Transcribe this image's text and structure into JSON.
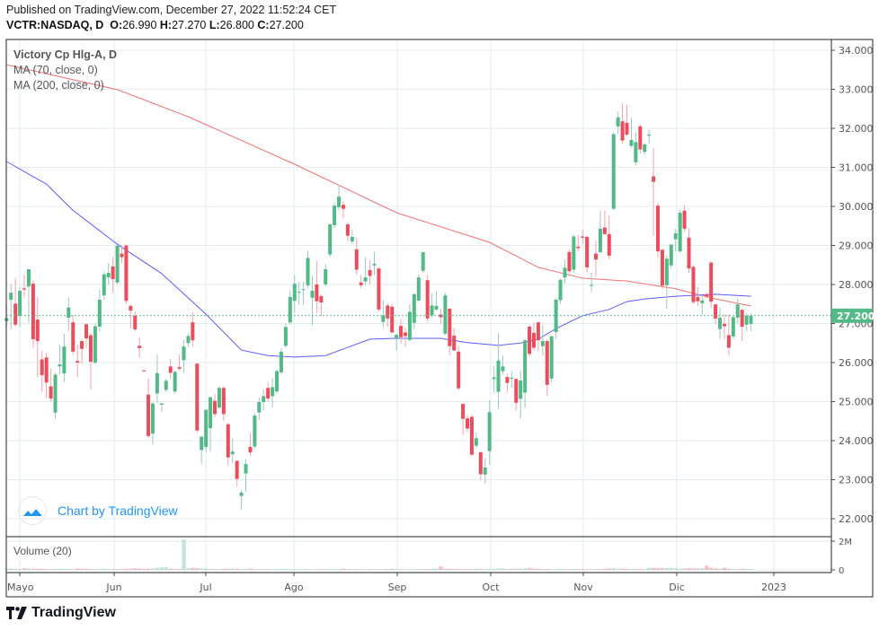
{
  "header": {
    "published": "Published on TradingView.com, December 27, 2022 11:52:24 CET",
    "symbol": "VCTR:NASDAQ, D",
    "open_label": "O:",
    "open": "26.990",
    "high_label": "H:",
    "high": "27.270",
    "low_label": "L:",
    "low": "26.800",
    "close_label": "C:",
    "close": "27.200"
  },
  "legend": {
    "title": "Victory Cp Hlg-A, D",
    "ma1": "MA (70, close, 0)",
    "ma2": "MA (200, close, 0)",
    "volume": "Volume (20)"
  },
  "watermark": "Chart by TradingView",
  "footer_logo": "TradingView",
  "colors": {
    "up": "#53b987",
    "down": "#eb4d5c",
    "ma70": "#5b5bff",
    "ma200": "#f47373",
    "last_price": "#53b987"
  },
  "chart_data": {
    "type": "candlestick",
    "title": "Victory Cp Hlg-A, D",
    "x_tick_labels": [
      "Mayo",
      "Jun",
      "Jul",
      "Ago",
      "Sep",
      "Oct",
      "Nov",
      "Dic",
      "2023"
    ],
    "y_tick_labels": [
      "34.000",
      "33.000",
      "32.000",
      "31.000",
      "30.000",
      "29.000",
      "28.000",
      "27.000",
      "26.000",
      "25.000",
      "24.000",
      "23.000",
      "22.000"
    ],
    "ylim": [
      22,
      34
    ],
    "grid": true,
    "last_price": "27.200",
    "candles_ohlc": [
      [
        27.06,
        27.5,
        26.9,
        27.14
      ],
      [
        27.61,
        28.0,
        26.85,
        27.79
      ],
      [
        27.51,
        28.17,
        26.92,
        26.97
      ],
      [
        27.2,
        27.95,
        26.9,
        27.84
      ],
      [
        27.9,
        28.25,
        27.67,
        27.87
      ],
      [
        27.95,
        28.39,
        27.03,
        28.39
      ],
      [
        28.02,
        28.1,
        26.38,
        26.6
      ],
      [
        27.1,
        27.67,
        25.63,
        26.55
      ],
      [
        26.08,
        26.3,
        25.25,
        25.68
      ],
      [
        26.13,
        26.24,
        25.08,
        25.49
      ],
      [
        25.39,
        25.85,
        25.0,
        25.08
      ],
      [
        24.72,
        25.74,
        24.57,
        25.69
      ],
      [
        25.9,
        26.46,
        25.69,
        25.95
      ],
      [
        25.72,
        26.74,
        25.5,
        26.41
      ],
      [
        27.15,
        27.67,
        26.8,
        27.41
      ],
      [
        27.03,
        27.22,
        26.2,
        26.28
      ],
      [
        26.04,
        26.47,
        25.63,
        26.0
      ],
      [
        26.55,
        26.6,
        25.97,
        26.35
      ],
      [
        26.98,
        27.0,
        26.37,
        26.62
      ],
      [
        26.7,
        26.75,
        25.3,
        26.02
      ],
      [
        26.0,
        27.0,
        25.95,
        26.93
      ],
      [
        26.92,
        27.87,
        26.8,
        27.61
      ],
      [
        27.72,
        28.33,
        27.6,
        28.26
      ],
      [
        28.18,
        28.55,
        28.0,
        28.3
      ],
      [
        28.46,
        28.7,
        27.8,
        28.14
      ],
      [
        28.05,
        29.0,
        28.0,
        28.99
      ],
      [
        28.79,
        29.0,
        28.55,
        28.7
      ],
      [
        29.0,
        29.0,
        27.5,
        27.58
      ],
      [
        27.45,
        27.5,
        26.88,
        27.33
      ],
      [
        27.2,
        27.32,
        26.8,
        26.85
      ],
      [
        26.43,
        26.65,
        26.14,
        26.37
      ],
      [
        25.8,
        25.81,
        25.76,
        25.79
      ],
      [
        25.18,
        25.6,
        24.08,
        24.12
      ],
      [
        24.18,
        25.0,
        23.9,
        24.95
      ],
      [
        25.21,
        26.2,
        24.96,
        25.73
      ],
      [
        24.92,
        24.97,
        24.73,
        24.95
      ],
      [
        25.3,
        25.59,
        25.25,
        25.53
      ],
      [
        25.9,
        26.08,
        25.6,
        25.74
      ],
      [
        25.26,
        25.8,
        25.2,
        25.76
      ],
      [
        25.88,
        26.2,
        25.8,
        25.84
      ],
      [
        26.06,
        26.58,
        25.75,
        26.41
      ],
      [
        26.5,
        26.75,
        26.4,
        26.68
      ],
      [
        27.03,
        27.3,
        26.41,
        26.57
      ],
      [
        25.97,
        26.0,
        24.2,
        24.26
      ],
      [
        23.76,
        24.12,
        23.4,
        24.1
      ],
      [
        23.84,
        24.8,
        23.7,
        24.79
      ],
      [
        24.32,
        25.13,
        23.72,
        25.11
      ],
      [
        25.02,
        25.2,
        24.6,
        24.68
      ],
      [
        24.85,
        25.4,
        24.8,
        25.35
      ],
      [
        25.35,
        25.4,
        24.5,
        24.68
      ],
      [
        24.42,
        24.45,
        23.37,
        23.57
      ],
      [
        23.65,
        24.07,
        23.42,
        23.72
      ],
      [
        23.48,
        23.5,
        22.82,
        23.02
      ],
      [
        22.58,
        22.72,
        22.23,
        22.67
      ],
      [
        23.16,
        23.52,
        22.68,
        23.4
      ],
      [
        23.84,
        24.2,
        23.6,
        23.7
      ],
      [
        23.85,
        24.7,
        23.8,
        24.64
      ],
      [
        24.72,
        25.1,
        24.53,
        24.99
      ],
      [
        24.99,
        25.3,
        24.78,
        25.14
      ],
      [
        25.35,
        25.5,
        25.0,
        25.08
      ],
      [
        25.14,
        25.6,
        24.84,
        25.37
      ],
      [
        25.26,
        25.83,
        25.2,
        25.78
      ],
      [
        25.75,
        26.37,
        25.7,
        26.28
      ],
      [
        26.43,
        27.0,
        26.38,
        26.91
      ],
      [
        27.03,
        27.84,
        26.97,
        27.68
      ],
      [
        27.58,
        28.25,
        27.27,
        28.02
      ],
      [
        27.79,
        28.07,
        27.48,
        27.81
      ],
      [
        27.88,
        28.07,
        27.48,
        27.88
      ],
      [
        27.98,
        28.87,
        27.9,
        28.68
      ],
      [
        27.66,
        28.22,
        26.95,
        27.84
      ],
      [
        28.0,
        28.6,
        27.27,
        27.57
      ],
      [
        27.7,
        27.75,
        27.18,
        27.54
      ],
      [
        28.0,
        28.52,
        27.95,
        28.39
      ],
      [
        28.77,
        29.56,
        28.7,
        29.54
      ],
      [
        29.52,
        30.1,
        29.45,
        30.02
      ],
      [
        29.98,
        30.55,
        29.9,
        30.25
      ],
      [
        30.04,
        30.14,
        29.7,
        29.94
      ],
      [
        29.54,
        29.6,
        29.1,
        29.25
      ],
      [
        29.1,
        29.4,
        29.04,
        29.22
      ],
      [
        28.9,
        29.2,
        28.24,
        28.38
      ],
      [
        28.05,
        28.25,
        27.9,
        27.98
      ],
      [
        28.08,
        28.7,
        27.98,
        28.18
      ],
      [
        28.37,
        28.62,
        27.99,
        28.22
      ],
      [
        28.49,
        28.84,
        28.24,
        28.53
      ],
      [
        28.41,
        28.45,
        27.3,
        27.36
      ],
      [
        27.04,
        27.6,
        26.9,
        27.21
      ],
      [
        27.46,
        27.52,
        26.92,
        27.13
      ],
      [
        27.43,
        27.5,
        26.77,
        26.77
      ],
      [
        26.62,
        26.74,
        26.32,
        26.71
      ],
      [
        26.94,
        27.12,
        26.48,
        26.65
      ],
      [
        26.77,
        26.9,
        26.4,
        26.68
      ],
      [
        26.58,
        27.5,
        26.55,
        27.3
      ],
      [
        27.02,
        27.78,
        26.86,
        27.75
      ],
      [
        27.59,
        28.25,
        27.55,
        28.18
      ],
      [
        28.35,
        28.83,
        28.3,
        28.83
      ],
      [
        28.11,
        28.25,
        27.06,
        27.13
      ],
      [
        27.21,
        27.77,
        27.15,
        27.46
      ],
      [
        27.36,
        27.82,
        27.33,
        27.45
      ],
      [
        27.23,
        27.39,
        26.99,
        27.16
      ],
      [
        26.74,
        27.79,
        26.7,
        27.72
      ],
      [
        27.38,
        27.4,
        26.19,
        26.42
      ],
      [
        26.69,
        26.89,
        26.3,
        26.31
      ],
      [
        26.28,
        26.42,
        25.29,
        25.34
      ],
      [
        24.94,
        24.95,
        24.14,
        24.56
      ],
      [
        24.57,
        24.65,
        24.22,
        24.31
      ],
      [
        24.61,
        24.67,
        23.58,
        23.64
      ],
      [
        23.87,
        24.21,
        23.8,
        24.06
      ],
      [
        23.7,
        23.72,
        22.98,
        23.14
      ],
      [
        23.13,
        23.55,
        22.9,
        23.31
      ],
      [
        23.73,
        25.04,
        23.38,
        24.73
      ],
      [
        25.58,
        25.9,
        25.22,
        25.62
      ],
      [
        25.25,
        26.76,
        24.82,
        26.05
      ],
      [
        25.78,
        26.18,
        25.7,
        25.9
      ],
      [
        25.63,
        25.7,
        25.23,
        25.48
      ],
      [
        25.61,
        25.78,
        25.35,
        25.61
      ],
      [
        25.58,
        25.6,
        24.77,
        24.97
      ],
      [
        25.07,
        25.8,
        24.56,
        25.54
      ],
      [
        25.23,
        26.6,
        24.84,
        26.57
      ],
      [
        26.92,
        26.98,
        26.15,
        26.22
      ],
      [
        26.76,
        27.01,
        26.3,
        26.38
      ],
      [
        27.03,
        27.05,
        26.3,
        26.57
      ],
      [
        26.42,
        26.97,
        26.19,
        26.55
      ],
      [
        26.55,
        26.6,
        25.15,
        25.43
      ],
      [
        25.59,
        26.7,
        25.5,
        26.67
      ],
      [
        26.78,
        27.64,
        26.6,
        27.61
      ],
      [
        27.6,
        28.15,
        27.5,
        28.12
      ],
      [
        28.18,
        28.63,
        28.02,
        28.43
      ],
      [
        28.83,
        28.9,
        28.28,
        28.34
      ],
      [
        28.38,
        29.28,
        28.3,
        29.23
      ],
      [
        28.97,
        29.27,
        28.85,
        28.93
      ],
      [
        29.23,
        29.4,
        29.04,
        29.2
      ],
      [
        29.22,
        29.25,
        28.31,
        28.44
      ],
      [
        27.99,
        28.3,
        27.81,
        27.99
      ],
      [
        28.79,
        29.13,
        28.2,
        28.64
      ],
      [
        28.83,
        29.9,
        28.8,
        29.43
      ],
      [
        29.46,
        29.9,
        29.3,
        29.29
      ],
      [
        29.29,
        29.77,
        28.65,
        28.74
      ],
      [
        29.94,
        31.9,
        29.9,
        31.85
      ],
      [
        32.05,
        32.44,
        31.85,
        32.28
      ],
      [
        32.18,
        32.65,
        31.6,
        31.69
      ],
      [
        32.14,
        32.6,
        31.8,
        31.84
      ],
      [
        31.55,
        32.28,
        31.5,
        31.7
      ],
      [
        31.13,
        31.9,
        31.04,
        31.65
      ],
      [
        32.05,
        32.1,
        31.35,
        31.46
      ],
      [
        31.4,
        31.62,
        31.32,
        31.59
      ],
      [
        31.81,
        31.96,
        31.6,
        31.84
      ],
      [
        30.77,
        31.5,
        29.25,
        30.63
      ],
      [
        30.02,
        30.08,
        28.7,
        28.85
      ],
      [
        28.89,
        28.92,
        27.88,
        27.97
      ],
      [
        27.98,
        28.75,
        27.37,
        28.66
      ],
      [
        28.49,
        29.04,
        28.4,
        29.02
      ],
      [
        29.16,
        29.42,
        28.85,
        29.31
      ],
      [
        28.85,
        29.91,
        28.8,
        29.84
      ],
      [
        29.89,
        30.03,
        29.35,
        29.43
      ],
      [
        29.2,
        29.43,
        28.3,
        28.41
      ],
      [
        28.45,
        28.5,
        27.5,
        27.55
      ],
      [
        27.68,
        27.93,
        27.45,
        27.57
      ],
      [
        27.52,
        27.72,
        27.23,
        27.59
      ],
      [
        27.75,
        27.8,
        27.65,
        27.69
      ],
      [
        28.56,
        28.6,
        27.4,
        27.56
      ],
      [
        27.49,
        27.5,
        26.99,
        27.13
      ],
      [
        26.86,
        27.41,
        26.6,
        27.15
      ],
      [
        26.99,
        27.24,
        26.6,
        26.93
      ],
      [
        26.7,
        27.24,
        26.18,
        26.38
      ],
      [
        26.67,
        27.2,
        26.6,
        27.16
      ],
      [
        27.15,
        27.64,
        27.0,
        27.49
      ],
      [
        27.35,
        27.38,
        26.55,
        26.92
      ],
      [
        26.97,
        27.27,
        26.8,
        27.2
      ],
      [
        26.99,
        27.27,
        26.8,
        27.2
      ]
    ],
    "ma70": [
      [
        0,
        31.15
      ],
      [
        9,
        30.57
      ],
      [
        15,
        29.9
      ],
      [
        25,
        29.03
      ],
      [
        35,
        28.28
      ],
      [
        45,
        27.24
      ],
      [
        53,
        26.32
      ],
      [
        59,
        26.18
      ],
      [
        65,
        26.14
      ],
      [
        72,
        26.18
      ],
      [
        82,
        26.6
      ],
      [
        88,
        26.62
      ],
      [
        98,
        26.62
      ],
      [
        104,
        26.51
      ],
      [
        111,
        26.44
      ],
      [
        116,
        26.5
      ],
      [
        120,
        26.6
      ],
      [
        124,
        26.87
      ],
      [
        130,
        27.2
      ],
      [
        136,
        27.36
      ],
      [
        140,
        27.56
      ],
      [
        144,
        27.63
      ],
      [
        151,
        27.7
      ],
      [
        160,
        27.75
      ],
      [
        168,
        27.7
      ]
    ],
    "ma200": [
      [
        0,
        33.63
      ],
      [
        25,
        32.99
      ],
      [
        41,
        32.3
      ],
      [
        65,
        31.08
      ],
      [
        88,
        29.84
      ],
      [
        109,
        29.08
      ],
      [
        120,
        28.44
      ],
      [
        130,
        28.16
      ],
      [
        140,
        28.09
      ],
      [
        151,
        27.89
      ],
      [
        160,
        27.63
      ],
      [
        168,
        27.45
      ]
    ],
    "volume_ylim": [
      0,
      2
    ],
    "volume_tick_labels": [
      "2M",
      "0"
    ],
    "volume_millions": [
      0.08,
      0.1,
      0.07,
      0.06,
      0.12,
      0.1,
      0.09,
      0.07,
      0.08,
      0.06,
      0.05,
      0.08,
      0.09,
      0.07,
      0.06,
      0.05,
      0.1,
      0.09,
      0.08,
      0.06,
      0.05,
      0.07,
      0.08,
      0.06,
      0.05,
      0.07,
      0.06,
      0.08,
      0.09,
      0.12,
      0.1,
      0.07,
      0.09,
      0.1,
      0.15,
      0.18,
      0.2,
      0.09,
      0.08,
      0.07,
      2.1,
      0.1,
      0.15,
      0.12,
      0.1,
      0.09,
      0.08,
      0.06,
      0.05,
      0.08,
      0.07,
      0.1,
      0.09,
      0.06,
      0.08,
      0.1,
      0.07,
      0.05,
      0.06,
      0.05,
      0.04,
      0.05,
      0.06,
      0.05,
      0.04,
      0.05,
      0.04,
      0.05,
      0.04,
      0.03,
      0.05,
      0.04,
      0.05,
      0.04,
      0.04,
      0.06,
      0.08,
      0.05,
      0.04,
      0.05,
      0.04,
      0.03,
      0.05,
      0.04,
      0.04,
      0.05,
      0.06,
      0.08,
      0.05,
      0.04,
      0.03,
      0.05,
      0.04,
      0.06,
      0.05,
      0.06,
      0.08,
      0.1,
      0.25,
      0.1,
      0.08,
      0.07,
      0.06,
      0.05,
      0.04,
      0.06,
      0.1,
      0.08,
      0.06,
      0.05,
      0.07,
      0.1,
      0.12,
      0.05,
      0.1,
      0.08,
      0.1,
      0.09,
      0.14,
      0.09,
      0.08,
      0.07,
      0.06,
      0.05,
      0.06,
      0.08,
      0.07,
      0.05,
      0.06,
      0.05,
      0.06,
      0.05,
      0.04,
      0.05,
      0.06,
      0.08,
      0.1,
      0.12,
      0.08,
      0.1,
      0.07,
      0.06,
      0.08,
      0.07,
      0.06,
      0.15,
      0.15,
      0.12,
      0.13,
      0.14,
      0.13,
      0.1,
      0.09,
      0.1,
      0.12,
      0.11,
      0.09,
      0.12,
      0.3,
      0.15,
      0.1,
      0.08,
      0.15,
      0.09,
      0.07,
      0.06,
      0.08,
      0.07,
      0.06
    ]
  }
}
